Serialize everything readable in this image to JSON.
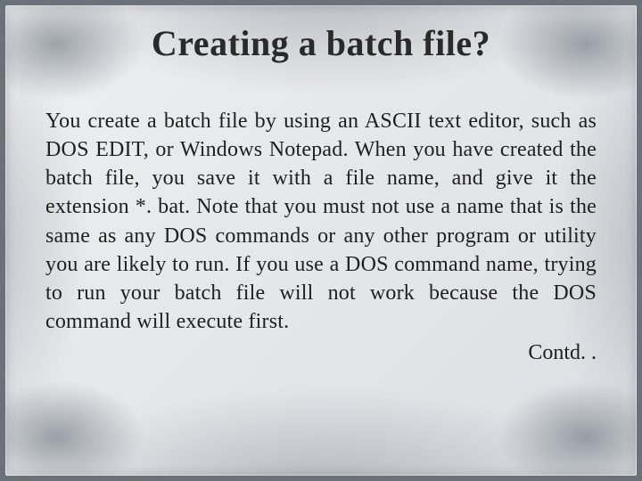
{
  "slide": {
    "title": "Creating a batch file?",
    "body": "You create a batch file by using an ASCII text editor, such as DOS EDIT, or Windows Notepad. When you have created the batch file, you save it with a file name, and give it the extension *. bat. Note that you must not use a name that is the same as any DOS commands or any other program or utility you are likely to run. If you use a DOS command name, trying to run your batch file will not work because the DOS command will execute first.",
    "contd": "Contd. ."
  }
}
